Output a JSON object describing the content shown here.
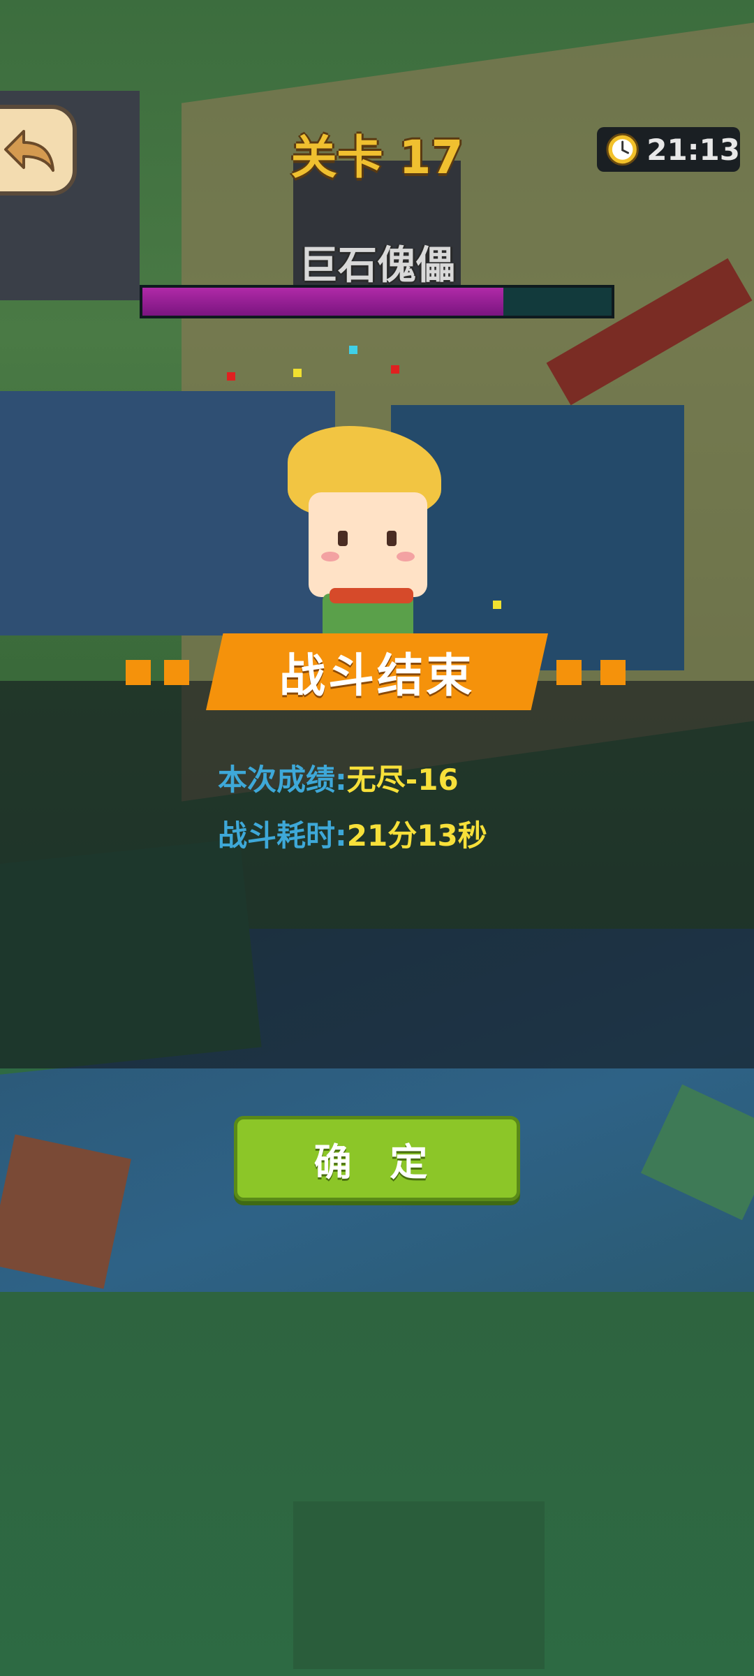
{
  "header": {
    "level_title": "关卡 17",
    "timer": "21:13"
  },
  "boss": {
    "name": "巨石傀儡",
    "health_fraction": 0.77,
    "health_color": "#a0209c"
  },
  "result": {
    "banner_title": "战斗结束",
    "score_label": "本次成绩:",
    "score_value": "无尽-16",
    "time_label": "战斗耗时:",
    "time_value": "21分13秒"
  },
  "buttons": {
    "confirm": "确 定",
    "back_icon": "back-arrow-icon"
  },
  "colors": {
    "banner": "#f5920b",
    "label": "#3ea8d8",
    "value": "#f7e03a",
    "confirm": "#8cc628"
  }
}
